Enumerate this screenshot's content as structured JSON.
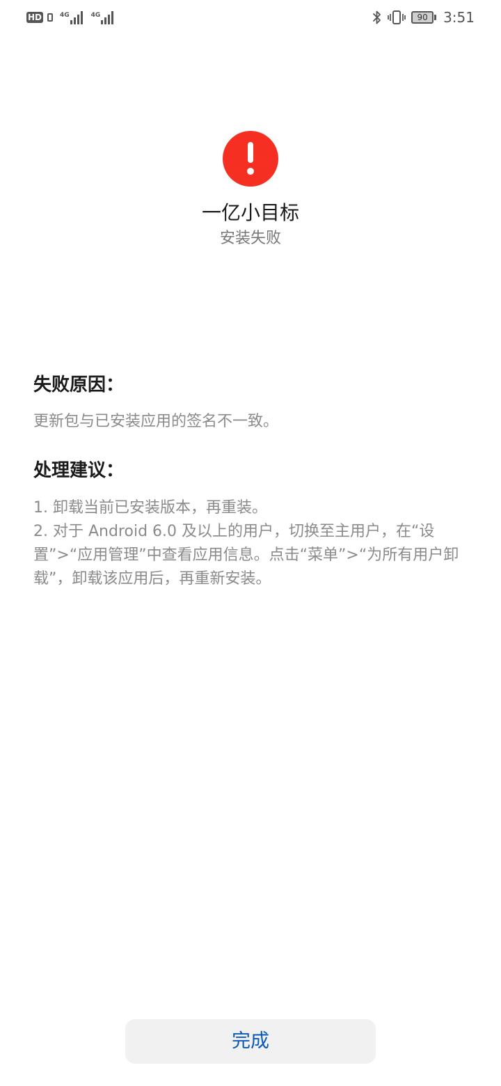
{
  "status_bar": {
    "hd_label": "HD",
    "sim1_network": "4G",
    "sim2_network": "4G",
    "battery_level": "90",
    "time": "3:51",
    "icons": [
      "hd-voice-icon",
      "sim-icon",
      "signal-icon",
      "bluetooth-icon",
      "vibrate-icon",
      "battery-icon"
    ]
  },
  "header": {
    "alert_icon": "exclamation-circle-icon",
    "alert_color": "#f53022",
    "app_name": "一亿小目标",
    "status": "安装失败"
  },
  "reason": {
    "title": "失败原因：",
    "text": "更新包与已安装应用的签名不一致。"
  },
  "suggestion": {
    "title": "处理建议：",
    "items": [
      "1. 卸载当前已安装版本，再重装。",
      "2. 对于 Android 6.0 及以上的用户，切换至主用户，在“设置”>“应用管理”中查看应用信息。点击“菜单”>“为所有用户卸载”，卸载该应用后，再重新安装。"
    ]
  },
  "footer": {
    "done_label": "完成",
    "accent_color": "#0a59b8"
  }
}
